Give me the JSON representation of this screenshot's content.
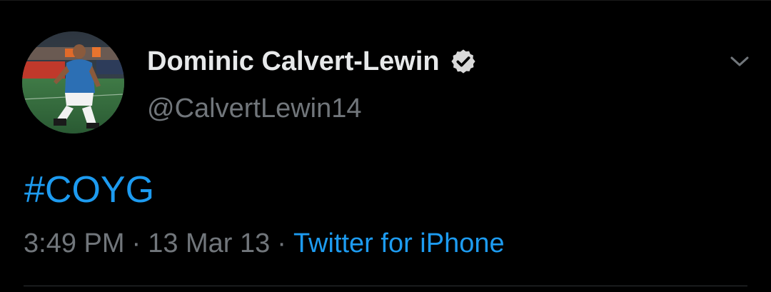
{
  "tweet": {
    "author": {
      "display_name": "Dominic Calvert-Lewin",
      "handle": "@CalvertLewin14",
      "verified": true,
      "avatar_icon": "profile-photo-player-celebrating"
    },
    "text_hashtag": "#COYG",
    "time": "3:49 PM",
    "separator": "·",
    "date": "13 Mar 13",
    "source": "Twitter for iPhone",
    "more_icon": "chevron-down-icon"
  },
  "colors": {
    "background": "#000000",
    "primary_text": "#e7e9ea",
    "secondary_text": "#71767b",
    "link": "#1d9bf0"
  }
}
